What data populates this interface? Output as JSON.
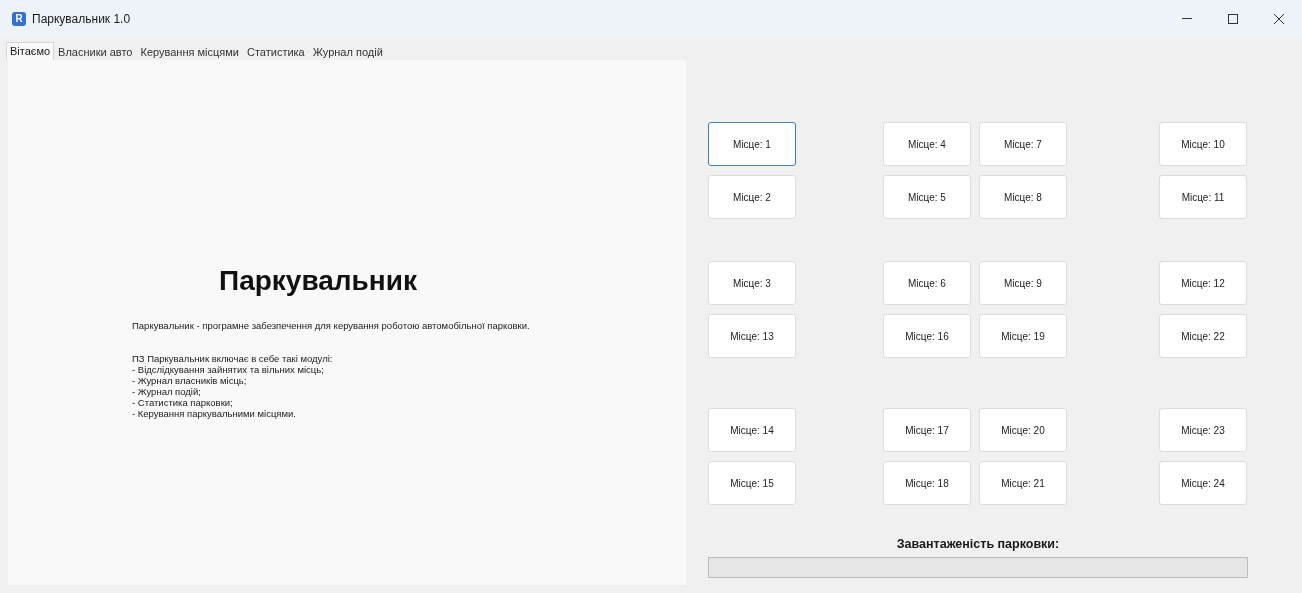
{
  "window": {
    "title": "Паркувальник 1.0",
    "app_icon": "R"
  },
  "tabs": [
    {
      "label": "Вітаємо",
      "selected": true
    },
    {
      "label": "Власники авто",
      "selected": false
    },
    {
      "label": "Керування місцями",
      "selected": false
    },
    {
      "label": "Статистика",
      "selected": false
    },
    {
      "label": "Журнал подій",
      "selected": false
    }
  ],
  "welcome": {
    "heading": "Паркувальник",
    "description": "Паркувальник - програмне забезпечення для керування роботою автомобільної парковки.",
    "modules_title": "ПЗ Паркувальник включає в себе такі модулі:",
    "modules": [
      "- Відслідкування зайнятих та вільних місць;",
      "- Журнал власників місць;",
      "- Журнал подій;",
      "- Статистика парковки;",
      "- Керування паркувальними місцями."
    ]
  },
  "spots": [
    {
      "label": "Місце: 1",
      "selected": true
    },
    {
      "label": "Місце: 4",
      "selected": false
    },
    {
      "label": "Місце: 7",
      "selected": false
    },
    {
      "label": "Місце: 10",
      "selected": false
    },
    {
      "label": "Місце: 2",
      "selected": false
    },
    {
      "label": "Місце: 5",
      "selected": false
    },
    {
      "label": "Місце: 8",
      "selected": false
    },
    {
      "label": "Місце: 11",
      "selected": false
    },
    {
      "label": "Місце: 3",
      "selected": false
    },
    {
      "label": "Місце: 6",
      "selected": false
    },
    {
      "label": "Місце: 9",
      "selected": false
    },
    {
      "label": "Місце: 12",
      "selected": false
    },
    {
      "label": "Місце: 13",
      "selected": false
    },
    {
      "label": "Місце: 16",
      "selected": false
    },
    {
      "label": "Місце: 19",
      "selected": false
    },
    {
      "label": "Місце: 22",
      "selected": false
    },
    {
      "label": "Місце: 14",
      "selected": false
    },
    {
      "label": "Місце: 17",
      "selected": false
    },
    {
      "label": "Місце: 20",
      "selected": false
    },
    {
      "label": "Місце: 23",
      "selected": false
    },
    {
      "label": "Місце: 15",
      "selected": false
    },
    {
      "label": "Місце: 18",
      "selected": false
    },
    {
      "label": "Місце: 21",
      "selected": false
    },
    {
      "label": "Місце: 24",
      "selected": false
    }
  ],
  "occupancy": {
    "label": "Завантаженість парковки:",
    "level": 0
  }
}
